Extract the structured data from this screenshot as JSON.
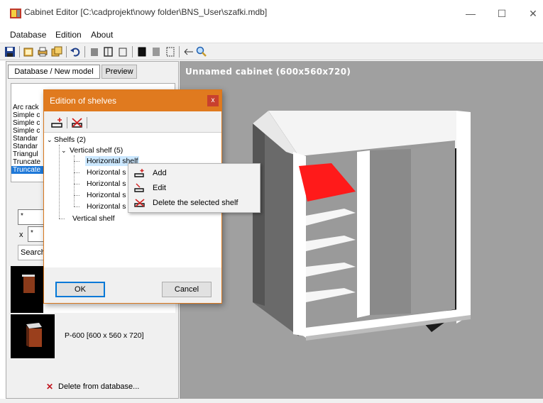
{
  "window": {
    "title": "Cabinet Editor [C:\\cadprojekt\\nowy folder\\BNS_User\\szafki.mdb]",
    "minimize": "—",
    "maximize": "☐",
    "close": "✕"
  },
  "menu": [
    "Database",
    "Edition",
    "About"
  ],
  "left": {
    "tab_active": "Database / New model",
    "tab_preview": "Preview",
    "list_items": [
      "Arc rack",
      "Simple c",
      "Simple c",
      "Simple c",
      "Standar",
      "Standar",
      "Triangul",
      "Truncate",
      "Truncate"
    ],
    "filter1": "*",
    "x_label": "x",
    "filter2": "*",
    "search_btn": "Search",
    "model_label": "P-600  [600 x 560 x 720]",
    "delete_btn": "Delete from database..."
  },
  "viewport": {
    "title": "Unnamed cabinet (600x560x720)"
  },
  "dialog": {
    "title": "Edition of shelves",
    "close": "x",
    "tree": {
      "root": "Shelfs (2)",
      "vertical_group": "Vertical shelf (5)",
      "items": [
        "Horizontal shelf",
        "Horizontal s",
        "Horizontal s",
        "Horizontal s",
        "Horizontal s"
      ],
      "vertical_single": "Vertical shelf"
    },
    "ok": "OK",
    "cancel": "Cancel"
  },
  "context_menu": {
    "add": "Add",
    "edit": "Edit",
    "delete": "Delete the selected shelf"
  },
  "colors": {
    "accent": "#e07a1f",
    "selection": "#cce8ff",
    "shelf_red": "#ff1a1a"
  }
}
